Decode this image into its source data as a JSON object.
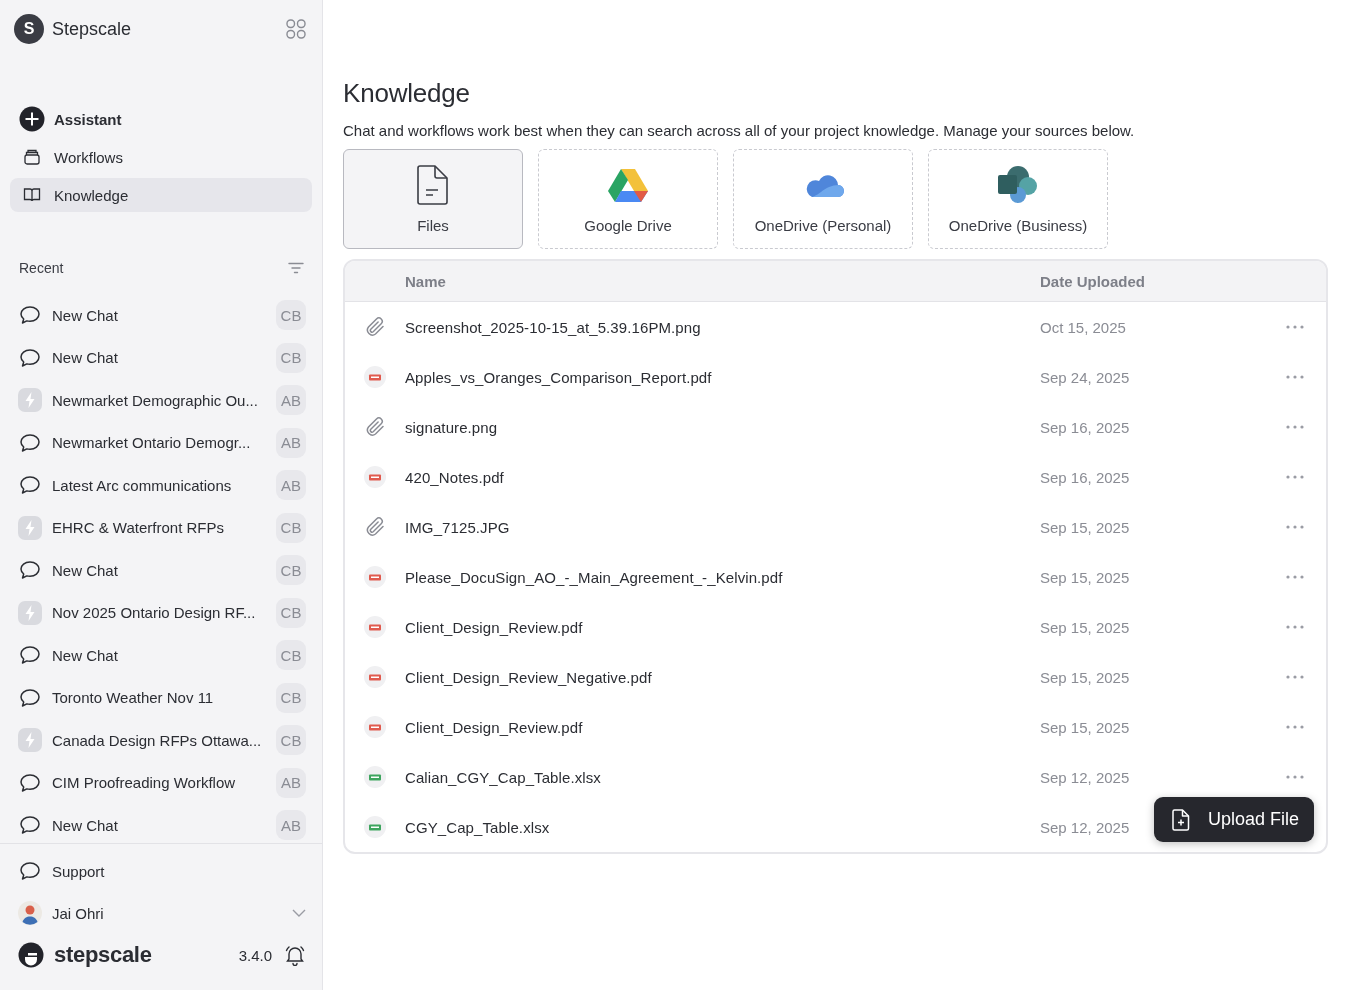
{
  "workspace": {
    "initial": "S",
    "name": "Stepscale"
  },
  "nav": [
    {
      "label": "Assistant",
      "kind": "assistant",
      "selected": false
    },
    {
      "label": "Workflows",
      "kind": "workflows",
      "selected": false
    },
    {
      "label": "Knowledge",
      "kind": "knowledge",
      "selected": true
    }
  ],
  "recent": {
    "title": "Recent",
    "items": [
      {
        "label": "New Chat",
        "kind": "chat",
        "badge": "CB"
      },
      {
        "label": "New Chat",
        "kind": "chat",
        "badge": "CB"
      },
      {
        "label": "Newmarket Demographic Ou...",
        "kind": "workflow",
        "badge": "AB"
      },
      {
        "label": "Newmarket Ontario Demogr...",
        "kind": "chat",
        "badge": "AB"
      },
      {
        "label": "Latest Arc communications",
        "kind": "chat",
        "badge": "AB"
      },
      {
        "label": "EHRC & Waterfront RFPs",
        "kind": "workflow",
        "badge": "CB"
      },
      {
        "label": "New Chat",
        "kind": "chat",
        "badge": "CB"
      },
      {
        "label": "Nov 2025 Ontario Design RF...",
        "kind": "workflow",
        "badge": "CB"
      },
      {
        "label": "New Chat",
        "kind": "chat",
        "badge": "CB"
      },
      {
        "label": "Toronto Weather Nov 11",
        "kind": "chat",
        "badge": "CB"
      },
      {
        "label": "Canada Design RFPs Ottawa...",
        "kind": "workflow",
        "badge": "CB"
      },
      {
        "label": "CIM Proofreading Workflow",
        "kind": "chat",
        "badge": "AB"
      },
      {
        "label": "New Chat",
        "kind": "chat",
        "badge": "AB"
      }
    ]
  },
  "support": "Support",
  "user": {
    "name": "Jai Ohri"
  },
  "footer": {
    "brand": "stepscale",
    "version": "3.4.0"
  },
  "page": {
    "title": "Knowledge",
    "description": "Chat and workflows work best when they can search across all of your project knowledge. Manage your sources below."
  },
  "sources": [
    {
      "label": "Files",
      "kind": "files",
      "selected": true
    },
    {
      "label": "Google Drive",
      "kind": "gdrive",
      "selected": false
    },
    {
      "label": "OneDrive (Personal)",
      "kind": "onedrive",
      "selected": false
    },
    {
      "label": "OneDrive (Business)",
      "kind": "sharepoint",
      "selected": false
    }
  ],
  "table": {
    "columns": [
      "Name",
      "Date Uploaded"
    ],
    "rows": [
      {
        "kind": "image",
        "name": "Screenshot_2025-10-15_at_5.39.16PM.png",
        "date": "Oct 15, 2025",
        "menu": true
      },
      {
        "kind": "pdf",
        "name": "Apples_vs_Oranges_Comparison_Report.pdf",
        "date": "Sep 24, 2025",
        "menu": true
      },
      {
        "kind": "image",
        "name": "signature.png",
        "date": "Sep 16, 2025",
        "menu": true
      },
      {
        "kind": "pdf",
        "name": "420_Notes.pdf",
        "date": "Sep 16, 2025",
        "menu": true
      },
      {
        "kind": "image",
        "name": "IMG_7125.JPG",
        "date": "Sep 15, 2025",
        "menu": true
      },
      {
        "kind": "pdf",
        "name": "Please_DocuSign_AO_-_Main_Agreement_-_Kelvin.pdf",
        "date": "Sep 15, 2025",
        "menu": true
      },
      {
        "kind": "pdf",
        "name": "Client_Design_Review.pdf",
        "date": "Sep 15, 2025",
        "menu": true
      },
      {
        "kind": "pdf",
        "name": "Client_Design_Review_Negative.pdf",
        "date": "Sep 15, 2025",
        "menu": true
      },
      {
        "kind": "pdf",
        "name": "Client_Design_Review.pdf",
        "date": "Sep 15, 2025",
        "menu": true
      },
      {
        "kind": "sheet",
        "name": "Calian_CGY_Cap_Table.xlsx",
        "date": "Sep 12, 2025",
        "menu": true
      },
      {
        "kind": "sheet",
        "name": "CGY_Cap_Table.xlsx",
        "date": "Sep 12, 2025",
        "menu": false
      }
    ]
  },
  "upload_button": "Upload File"
}
